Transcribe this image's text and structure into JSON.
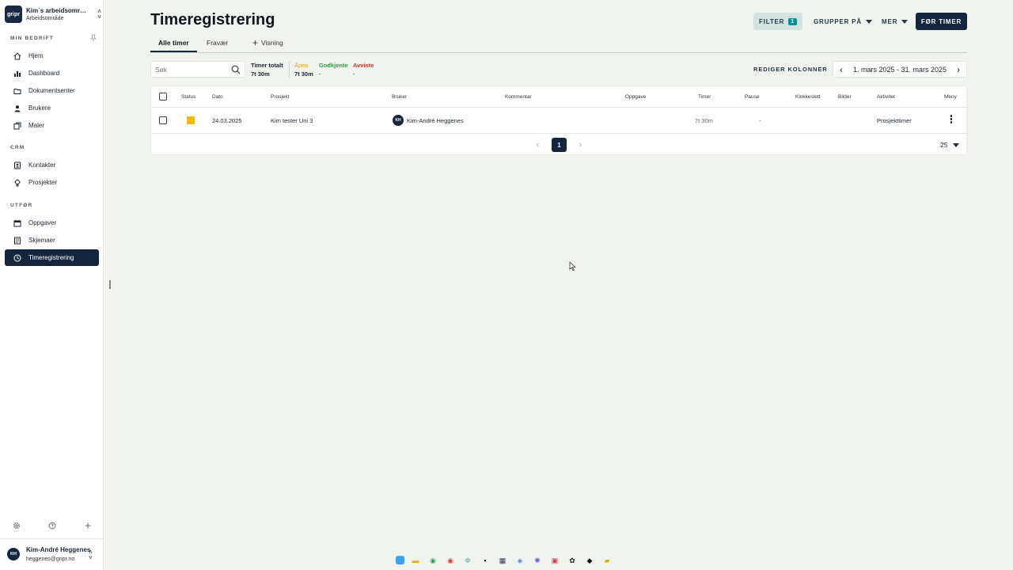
{
  "workspace": {
    "logo": "gripr",
    "name": "Kim`s arbeidsområd...",
    "sub": "Arbeidsområde"
  },
  "sidebar": {
    "sections": [
      "MIN BEDRIFT",
      "CRM",
      "UTFØR"
    ],
    "items": [
      {
        "label": "Hjem",
        "icon": "home-icon"
      },
      {
        "label": "Dashboard",
        "icon": "chart-icon"
      },
      {
        "label": "Dokumentsenter",
        "icon": "folder-icon"
      },
      {
        "label": "Brukere",
        "icon": "users-icon"
      },
      {
        "label": "Maler",
        "icon": "template-icon"
      },
      {
        "label": "Kontakter",
        "icon": "contact-icon"
      },
      {
        "label": "Prosjekter",
        "icon": "project-icon"
      },
      {
        "label": "Oppgaver",
        "icon": "calendar-icon"
      },
      {
        "label": "Skjemaer",
        "icon": "form-icon"
      },
      {
        "label": "Timeregistrering",
        "icon": "clock-icon",
        "active": true
      }
    ]
  },
  "user": {
    "initials": "KH",
    "name": "Kim-André Heggenes",
    "email": "heggenes@gripr.no"
  },
  "header": {
    "title": "Timeregistrering",
    "filter_label": "FILTER",
    "filter_count": "1",
    "group_label": "GRUPPER PÅ",
    "more_label": "MER",
    "primary_label": "FØR TIMER"
  },
  "tabs": [
    "Alle timer",
    "Fravær",
    "Visning"
  ],
  "search": {
    "placeholder": "Søk"
  },
  "stats": [
    {
      "label": "Timer totalt",
      "value": "7t 30m",
      "color": "#1b2430"
    },
    {
      "label": "Åpen",
      "value": "7t 30m",
      "color": "#e6a700"
    },
    {
      "label": "Godkjente",
      "value": "-",
      "color": "#2e9e3e"
    },
    {
      "label": "Avviste",
      "value": "-",
      "color": "#c0392b"
    }
  ],
  "edit_columns_label": "REDIGER KOLONNER",
  "date_range": "1. mars 2025 - 31. mars 2025",
  "table": {
    "columns": [
      "Status",
      "Dato",
      "Prosjekt",
      "Bruker",
      "Kommentar",
      "Oppgave",
      "Timer",
      "Pause",
      "Klokkeslett",
      "Bilder",
      "Aktivitet",
      "Meny"
    ],
    "row": {
      "status_color": "#f0b90b",
      "date": "24.03.2025",
      "project": "Kim tester Uni 3",
      "user_initials": "KH",
      "user": "Kim-André Heggenes",
      "hours": "7t 30m",
      "pause": "-",
      "activity": "Prosjekttimer"
    },
    "page": "1",
    "rows_per_page": "25"
  }
}
